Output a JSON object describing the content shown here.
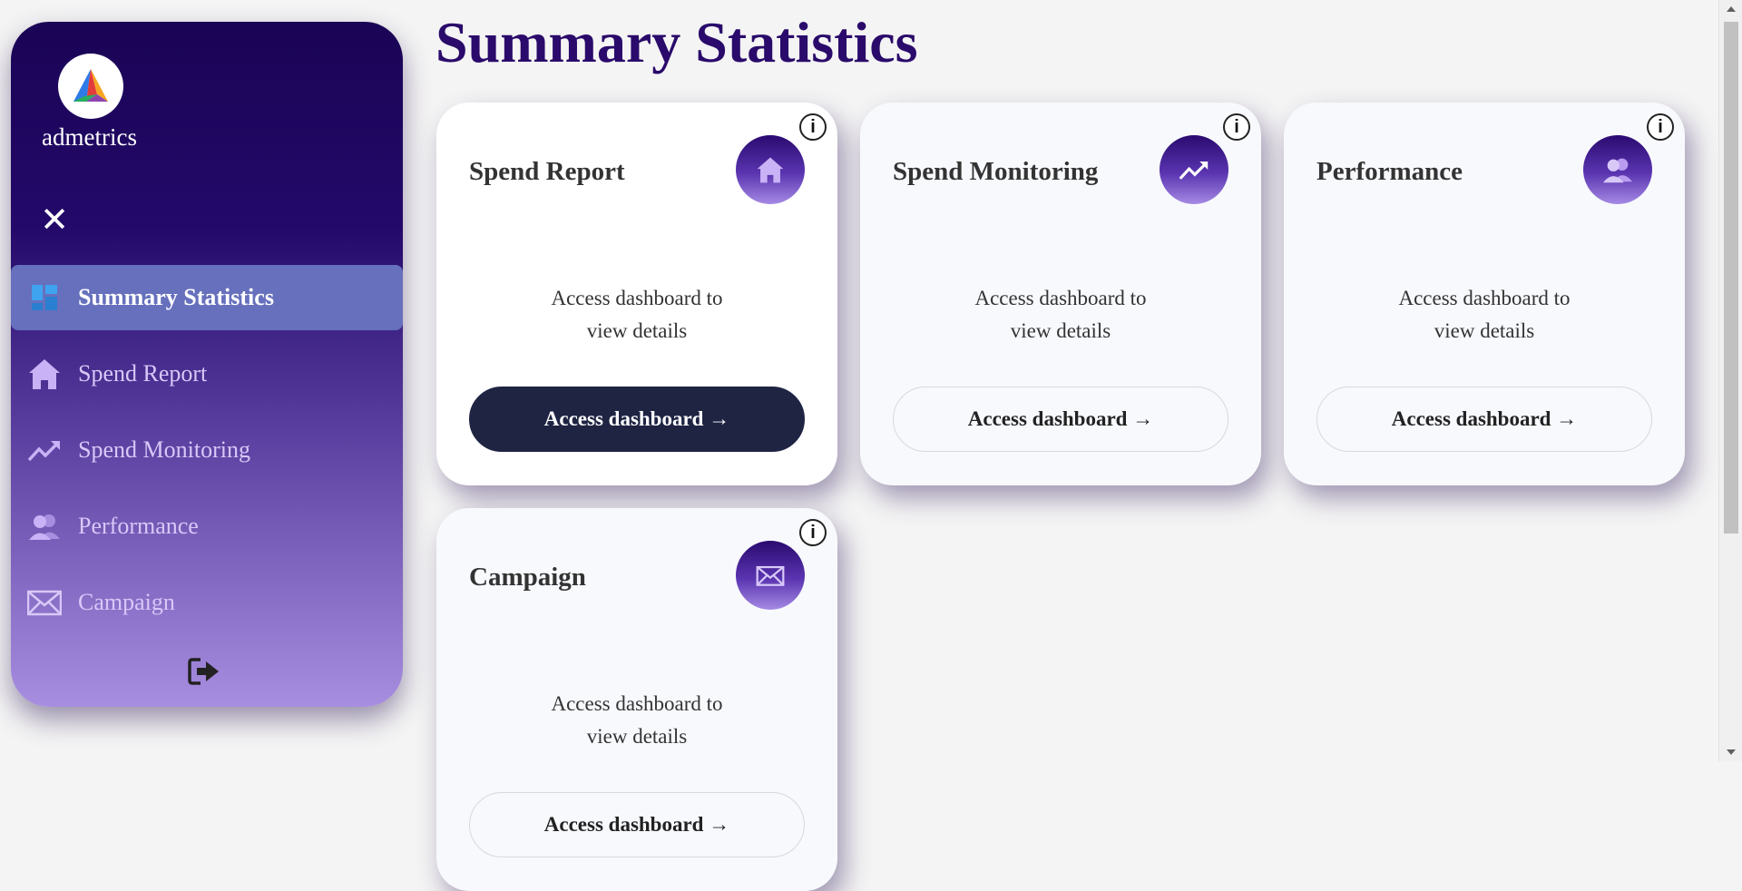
{
  "brand": {
    "name": "admetrics"
  },
  "page": {
    "title": "Summary Statistics"
  },
  "sidebar": {
    "items": [
      {
        "label": "Summary Statistics",
        "icon": "dashboard-icon",
        "active": true
      },
      {
        "label": "Spend Report",
        "icon": "home-icon",
        "active": false
      },
      {
        "label": "Spend Monitoring",
        "icon": "trending-up-icon",
        "active": false
      },
      {
        "label": "Performance",
        "icon": "users-icon",
        "active": false
      },
      {
        "label": "Campaign",
        "icon": "envelope-icon",
        "active": false
      }
    ],
    "close_glyph": "✕",
    "logout_icon": "logout-icon"
  },
  "cards": [
    {
      "title": "Spend Report",
      "icon": "home-icon",
      "desc_line1": "Access dashboard to",
      "desc_line2": "view details",
      "button": "Access dashboard →",
      "info": "i",
      "primary": true
    },
    {
      "title": "Spend Monitoring",
      "icon": "trending-up-icon",
      "desc_line1": "Access dashboard to",
      "desc_line2": "view details",
      "button": "Access dashboard →",
      "info": "i",
      "primary": false
    },
    {
      "title": "Performance",
      "icon": "users-icon",
      "desc_line1": "Access dashboard to",
      "desc_line2": "view details",
      "button": "Access dashboard →",
      "info": "i",
      "primary": false
    },
    {
      "title": "Campaign",
      "icon": "envelope-icon",
      "desc_line1": "Access dashboard to",
      "desc_line2": "view details",
      "button": "Access dashboard →",
      "info": "i",
      "primary": false
    }
  ],
  "colors": {
    "title": "#2a0a6a",
    "sidebar_top": "#1a0455",
    "sidebar_bottom": "#a88ee0",
    "active_item": "#6670bd",
    "primary_button": "#1f2443"
  }
}
